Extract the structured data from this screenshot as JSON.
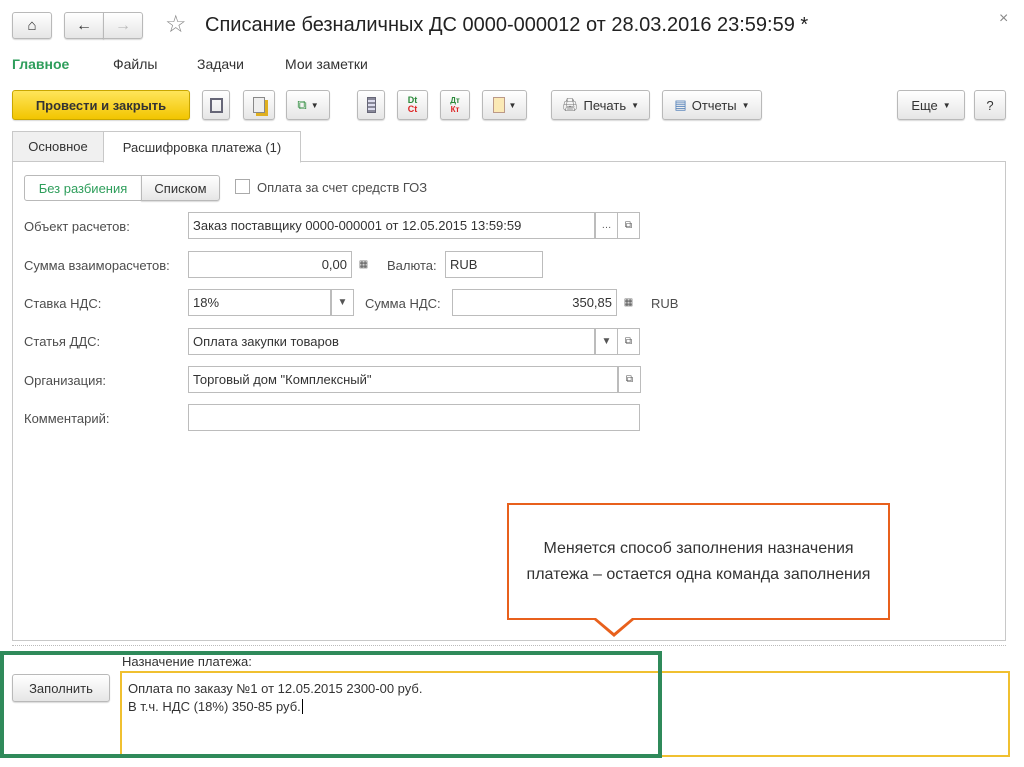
{
  "window": {
    "title": "Списание безналичных ДС 0000-000012 от 28.03.2016 23:59:59 *",
    "close": "×"
  },
  "nav": [
    {
      "label": "Главное"
    },
    {
      "label": "Файлы"
    },
    {
      "label": "Задачи"
    },
    {
      "label": "Мои заметки"
    }
  ],
  "toolbar": {
    "post_close": "Провести и закрыть",
    "print": "Печать",
    "reports": "Отчеты",
    "more": "Еще",
    "help": "?",
    "dt_ct": {
      "dt": "Dt",
      "ct": "Ct"
    },
    "dk": {
      "d": "Дт",
      "k": "Кт"
    }
  },
  "tabs": [
    {
      "label": "Основное"
    },
    {
      "label": "Расшифровка платежа (1)"
    }
  ],
  "mode": {
    "no_split": "Без разбиения",
    "list": "Списком",
    "goz_label": "Оплата за счет средств ГОЗ",
    "goz_checked": false
  },
  "form": {
    "settlement_object": {
      "label": "Объект расчетов:",
      "value": "Заказ поставщику 0000-000001 от 12.05.2015 13:59:59"
    },
    "settlement_sum": {
      "label": "Сумма взаиморасчетов:",
      "value": "0,00"
    },
    "currency": {
      "label": "Валюта:",
      "value": "RUB"
    },
    "vat_rate": {
      "label": "Ставка НДС:",
      "value": "18%"
    },
    "vat_sum": {
      "label": "Сумма НДС:",
      "value": "350,85",
      "currency": "RUB"
    },
    "cash_item": {
      "label": "Статья ДДС:",
      "value": "Оплата закупки товаров"
    },
    "organization": {
      "label": "Организация:",
      "value": "Торговый дом \"Комплексный\""
    },
    "comment": {
      "label": "Комментарий:",
      "value": ""
    }
  },
  "callout": {
    "text": "Меняется способ заполнения назначения платежа – остается одна команда заполнения",
    "color": "#e8601c"
  },
  "purpose": {
    "label": "Назначение платежа:",
    "fill_button": "Заполнить",
    "line1": "Оплата по заказу №1 от 12.05.2015 2300-00 руб.",
    "line2": "В т.ч. НДС (18%) 350-85 руб."
  },
  "colors": {
    "accent_green": "#2e9e5b",
    "yellow": "#f5c518",
    "highlight_green": "#2f8a5a",
    "highlight_yellow": "#f0c030"
  }
}
